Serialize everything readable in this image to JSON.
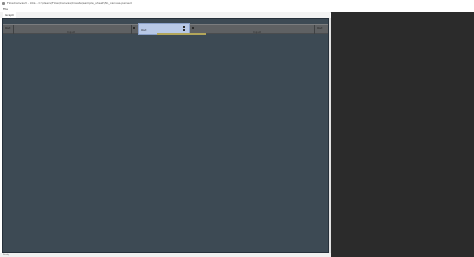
{
  "window": {
    "title": "FlowCanvas3 - Iota - C:\\Users\\Flow\\Canvas\\Create\\sample_sheet\\flo_canvas.parsed"
  },
  "menu": {
    "items": [
      {
        "label": "File"
      }
    ]
  },
  "tabs": [
    {
      "label": "Graph"
    }
  ],
  "canvas": {
    "strip_nodes": [
      {
        "title": "Out",
        "sub": ""
      },
      {
        "title": "",
        "sub": "Input"
      },
      {
        "title": "",
        "sub": ""
      },
      {
        "title": "",
        "sub": "Input"
      },
      {
        "title": "Out",
        "sub": ""
      }
    ],
    "selected_node": {
      "title": "Out",
      "bar_label": "Result"
    }
  },
  "colors": {
    "canvas_bg": "#3d4a54",
    "strip_bg": "#5f6163",
    "selected_bg": "#b8c8e6",
    "accent_yellow": "#e8dc8a",
    "side_panel_bg": "#2b2b2b"
  },
  "status": {
    "text": "Ready"
  }
}
